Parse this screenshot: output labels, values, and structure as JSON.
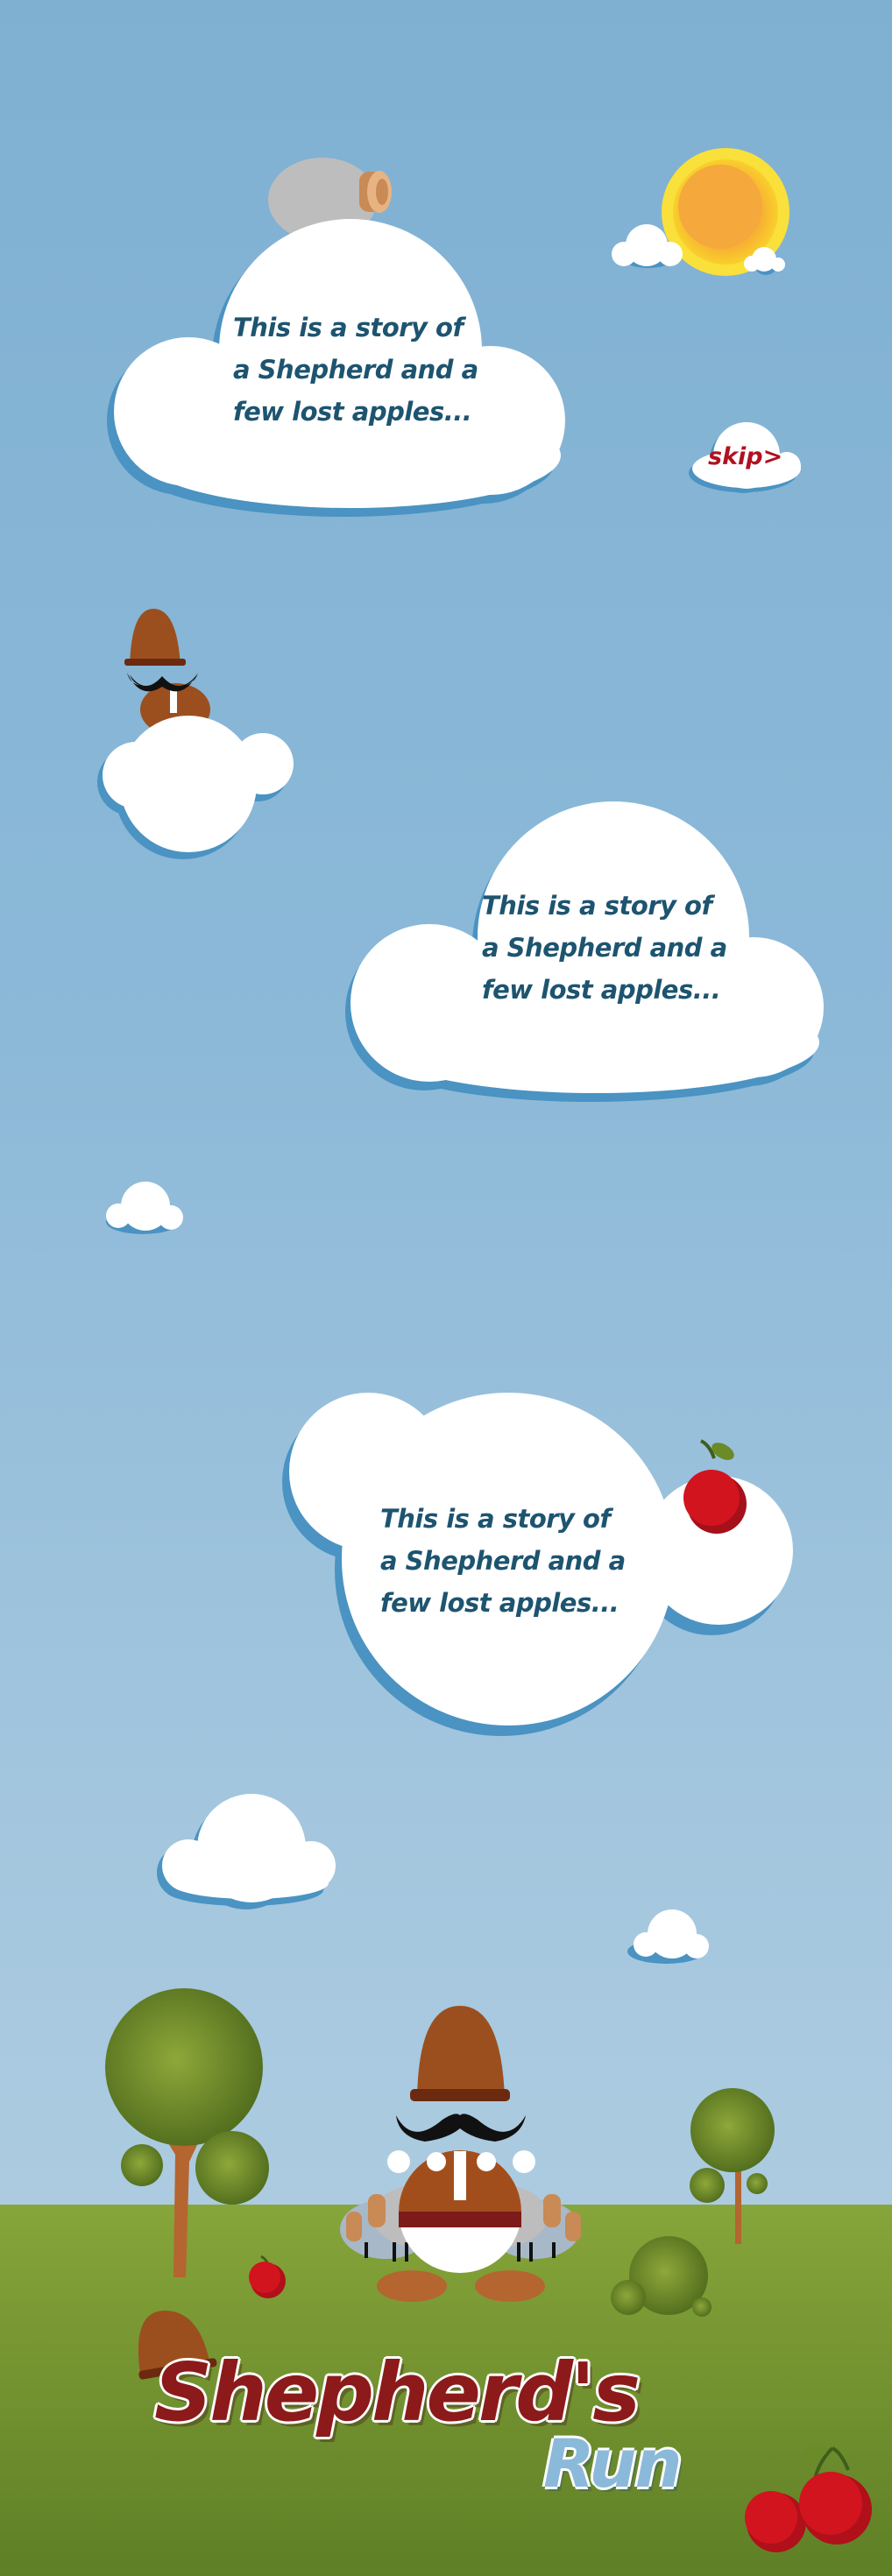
{
  "story": {
    "panel_1": [
      "This is a story of",
      "a Shepherd and a",
      "few lost apples..."
    ],
    "panel_2": [
      "This is a story of",
      "a Shepherd and a",
      "few lost apples..."
    ],
    "panel_3": [
      "This is a story of",
      "a Shepherd and a",
      "few lost apples..."
    ]
  },
  "skip_label": "skip>",
  "title": {
    "main": "Shepherd's",
    "sub": "Run"
  },
  "colors": {
    "sky_top": "#7fb0d2",
    "cloud": "#ffffff",
    "cloud_shadow": "#4a93c2",
    "story_text": "#1d5470",
    "skip_text": "#b01220",
    "grass": "#7a9a34",
    "hat_brown": "#9c4f1e",
    "apple_red": "#c4121b",
    "tree_green": "#6f8a2a",
    "sun": "#f6ae2d"
  },
  "icons": [
    "sun-icon",
    "sheep-icon",
    "shepherd-icon",
    "apple-icon",
    "tree-icon",
    "bush-icon",
    "hat-icon"
  ]
}
